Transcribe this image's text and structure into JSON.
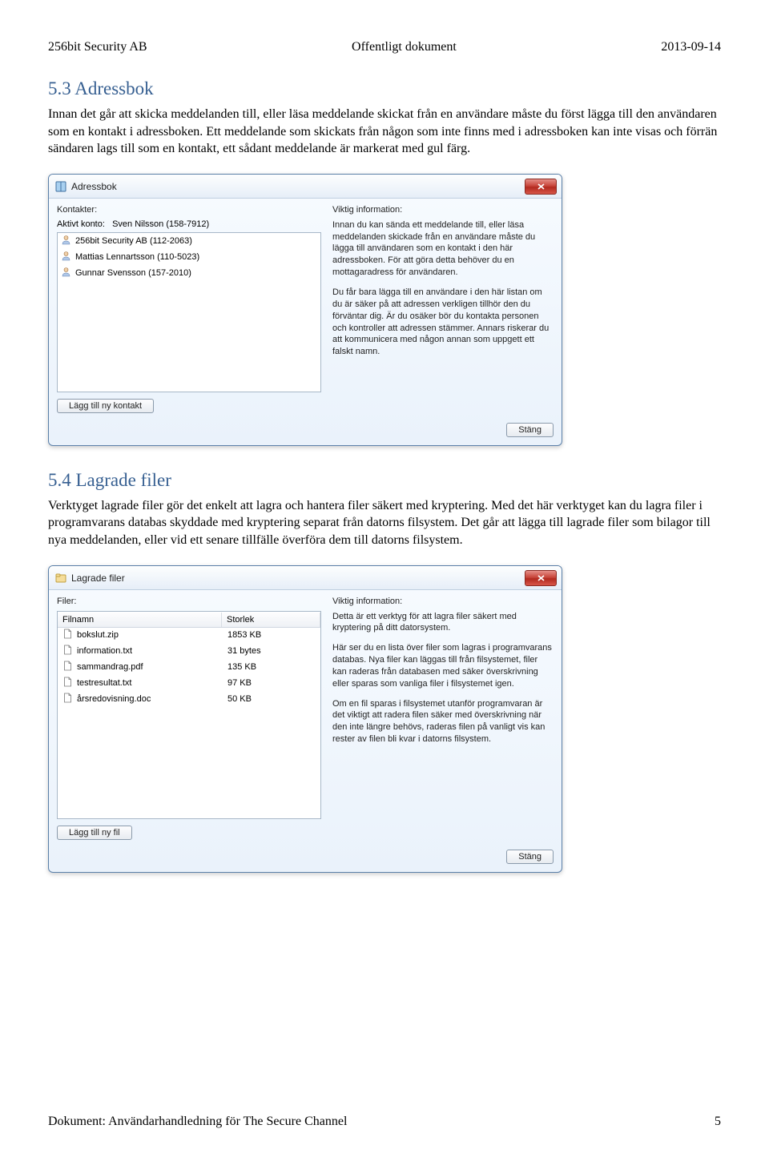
{
  "header": {
    "left": "256bit Security AB",
    "center": "Offentligt dokument",
    "right": "2013-09-14"
  },
  "section1": {
    "heading": "5.3 Adressbok",
    "body": "Innan det går att skicka meddelanden till, eller läsa meddelande skickat från en användare måste du först lägga till den användaren som en kontakt i adressboken. Ett meddelande som skickats från någon som inte finns med i adressboken kan inte visas och förrän sändaren lags till som en kontakt, ett sådant meddelande är markerat med gul färg."
  },
  "dialog1": {
    "title": "Adressbok",
    "left_label": "Kontakter:",
    "account_label": "Aktivt konto:",
    "account_name": "Sven Nilsson (158-7912)",
    "contacts": [
      "256bit Security AB (112-2063)",
      "Mattias Lennartsson (110-5023)",
      "Gunnar Svensson (157-2010)"
    ],
    "add_btn": "Lägg till ny kontakt",
    "right_label": "Viktig information:",
    "info_p1": "Innan du kan sända ett meddelande till, eller läsa meddelanden skickade från en användare måste du lägga till användaren som en kontakt i den här adressboken. För att göra detta behöver du en mottagaradress för användaren.",
    "info_p2": "Du får bara lägga till en användare i den här listan om du är säker på att adressen verkligen tillhör den du förväntar dig. Är du osäker bör du kontakta personen och kontroller att adressen stämmer. Annars riskerar du att kommunicera med någon annan som uppgett ett falskt namn.",
    "close_btn": "Stäng"
  },
  "section2": {
    "heading": "5.4 Lagrade filer",
    "body": "Verktyget lagrade filer gör det enkelt att lagra och hantera filer säkert med kryptering. Med det här verktyget kan du lagra filer i programvarans databas skyddade med kryptering separat från datorns filsystem. Det går att lägga till lagrade filer som bilagor till nya meddelanden, eller vid ett senare tillfälle överföra dem till datorns filsystem."
  },
  "dialog2": {
    "title": "Lagrade filer",
    "left_label": "Filer:",
    "header_name": "Filnamn",
    "header_size": "Storlek",
    "files": [
      {
        "name": "bokslut.zip",
        "size": "1853 KB"
      },
      {
        "name": "information.txt",
        "size": "31 bytes"
      },
      {
        "name": "sammandrag.pdf",
        "size": "135 KB"
      },
      {
        "name": "testresultat.txt",
        "size": "97 KB"
      },
      {
        "name": "årsredovisning.doc",
        "size": "50 KB"
      }
    ],
    "add_btn": "Lägg till ny fil",
    "right_label": "Viktig information:",
    "info_p1": "Detta är ett verktyg för att lagra filer säkert med kryptering på ditt datorsystem.",
    "info_p2": "Här ser du en lista över filer som lagras i programvarans databas. Nya filer kan läggas till från filsystemet, filer kan raderas från databasen med säker överskrivning eller sparas som vanliga filer i filsystemet igen.",
    "info_p3": "Om en fil sparas i filsystemet utanför programvaran är det viktigt att radera filen säker med överskrivning när den inte längre behövs, raderas filen på vanligt vis kan rester av filen bli kvar i datorns filsystem.",
    "close_btn": "Stäng"
  },
  "footer": {
    "left": "Dokument: Användarhandledning för The Secure Channel",
    "right": "5"
  }
}
